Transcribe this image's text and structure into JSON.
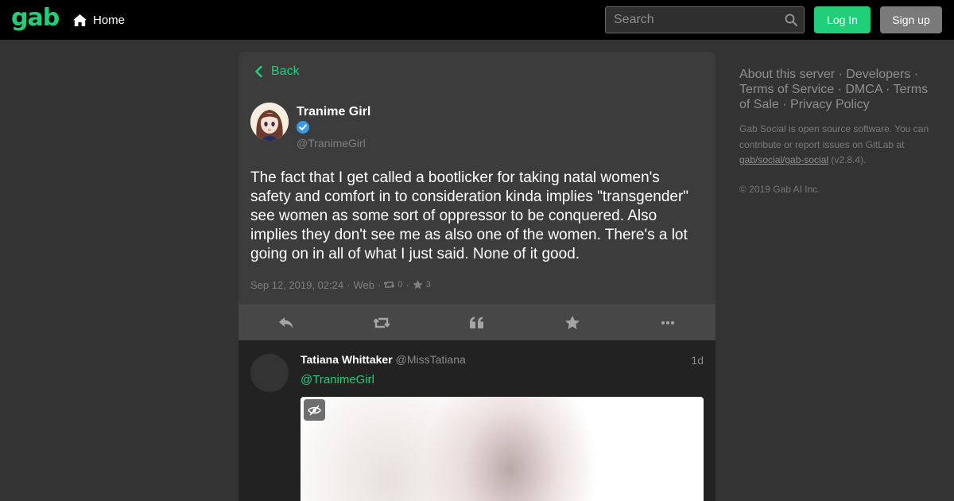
{
  "header": {
    "logo": "gab",
    "home_label": "Home",
    "search_placeholder": "Search",
    "login_label": "Log In",
    "signup_label": "Sign up",
    "accent_color": "#21cf7a"
  },
  "status": {
    "back_label": "Back",
    "author_name": "Tranime Girl",
    "author_handle": "@TranimeGirl",
    "verified": true,
    "text": "The fact that I get called a bootlicker for taking natal women's safety and comfort in to consideration kinda implies \"transgender\" see women as some sort of oppressor to be conquered. Also implies they don't see me as also one of the women. There's a lot going on in all of what I just said. None of it good.",
    "timestamp": "Sep 12, 2019, 02:24",
    "source": "Web",
    "separator": "·",
    "reblog_count": "0",
    "favourite_count": "3",
    "actions": [
      "reply-icon",
      "repost-icon",
      "quote-icon",
      "star-icon",
      "ellipsis-icon"
    ]
  },
  "reply": {
    "name": "Tatiana Whittaker",
    "handle": "@MissTatiana",
    "time": "1d",
    "mention": "@TranimeGirl",
    "media_hidden_icon": "eye-slash-icon"
  },
  "sidebar": {
    "links": [
      {
        "label": "About this server",
        "sep": "·"
      },
      {
        "label": "Developers",
        "sep": "·"
      },
      {
        "label": "Terms of Service",
        "sep": "·"
      },
      {
        "label": "DMCA",
        "sep": "·"
      },
      {
        "label": "Terms of Sale",
        "sep": "·"
      },
      {
        "label": "Privacy Policy",
        "sep": ""
      }
    ],
    "info_text": "Gab Social is open source software. You can contribute or report issues on GitLab at",
    "repo_link": "gab/social/gab-social",
    "version": "(v2.8.4).",
    "copyright": "© 2019 Gab AI Inc."
  }
}
